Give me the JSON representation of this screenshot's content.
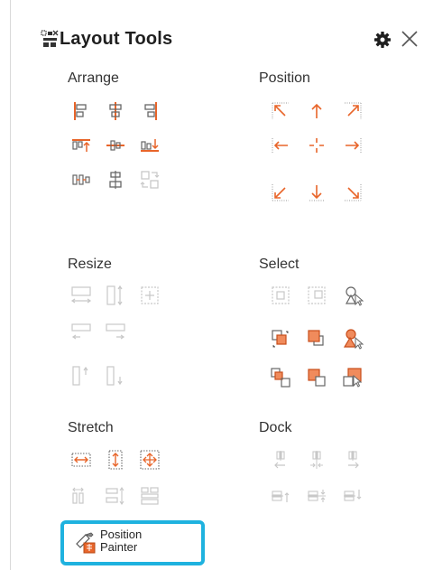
{
  "panel": {
    "title": "Layout Tools",
    "app_icon": "layout-tools-logo-icon",
    "settings_icon": "gear-icon",
    "close_icon": "close-icon"
  },
  "colors": {
    "accent": "#e8652a",
    "disabled": "#c8c8c8",
    "highlight_border": "#1fb2df",
    "text": "#262626"
  },
  "sections": {
    "arrange": "Arrange",
    "position": "Position",
    "resize": "Resize",
    "select": "Select",
    "stretch": "Stretch",
    "dock": "Dock"
  },
  "position_painter": {
    "line1": "Position",
    "line2": "Painter",
    "icon": "position-painter-icon"
  }
}
